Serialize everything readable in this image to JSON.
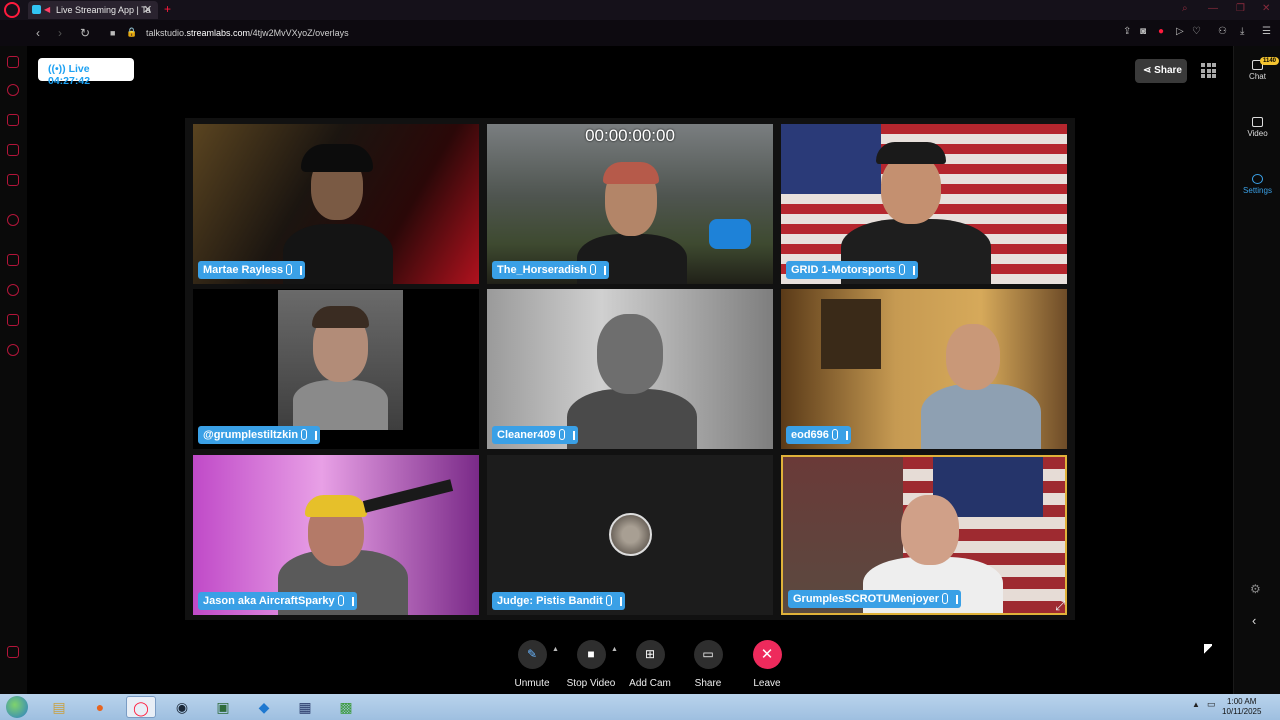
{
  "browser": {
    "tab_title": "Live Streaming App | Ta",
    "url_prefix": "talkstudio.",
    "url_domain": "streamlabs.com",
    "url_path": "/4tjw2MvVXyoZ/overlays"
  },
  "header": {
    "live_label": "Live 04:27:42",
    "share_label": "Share"
  },
  "right_panel": {
    "chat_label": "Chat",
    "chat_count": "1140",
    "video_label": "Video",
    "settings_label": "Settings"
  },
  "timer": "00:00:00:00",
  "participants": [
    {
      "name": "Martae Rayless"
    },
    {
      "name": "The_Horseradish"
    },
    {
      "name": "GRID 1-Motorsports"
    },
    {
      "name": "@grumplestiltzkin"
    },
    {
      "name": "Cleaner409"
    },
    {
      "name": "eod696"
    },
    {
      "name": "Jason aka AircraftSparky"
    },
    {
      "name": "Judge: Pistis Bandit"
    },
    {
      "name": "GrumplesSCROTUMenjoyer"
    }
  ],
  "controls": {
    "unmute": "Unmute",
    "stop_video": "Stop Video",
    "add_cam": "Add Cam",
    "share": "Share",
    "leave": "Leave"
  },
  "taskbar": {
    "time": "1:00 AM",
    "date": "10/11/2025"
  },
  "colors": {
    "accent_blue": "#3aa0e6",
    "leave_red": "#ee2a5c",
    "opera_red": "#ff1b3d"
  }
}
